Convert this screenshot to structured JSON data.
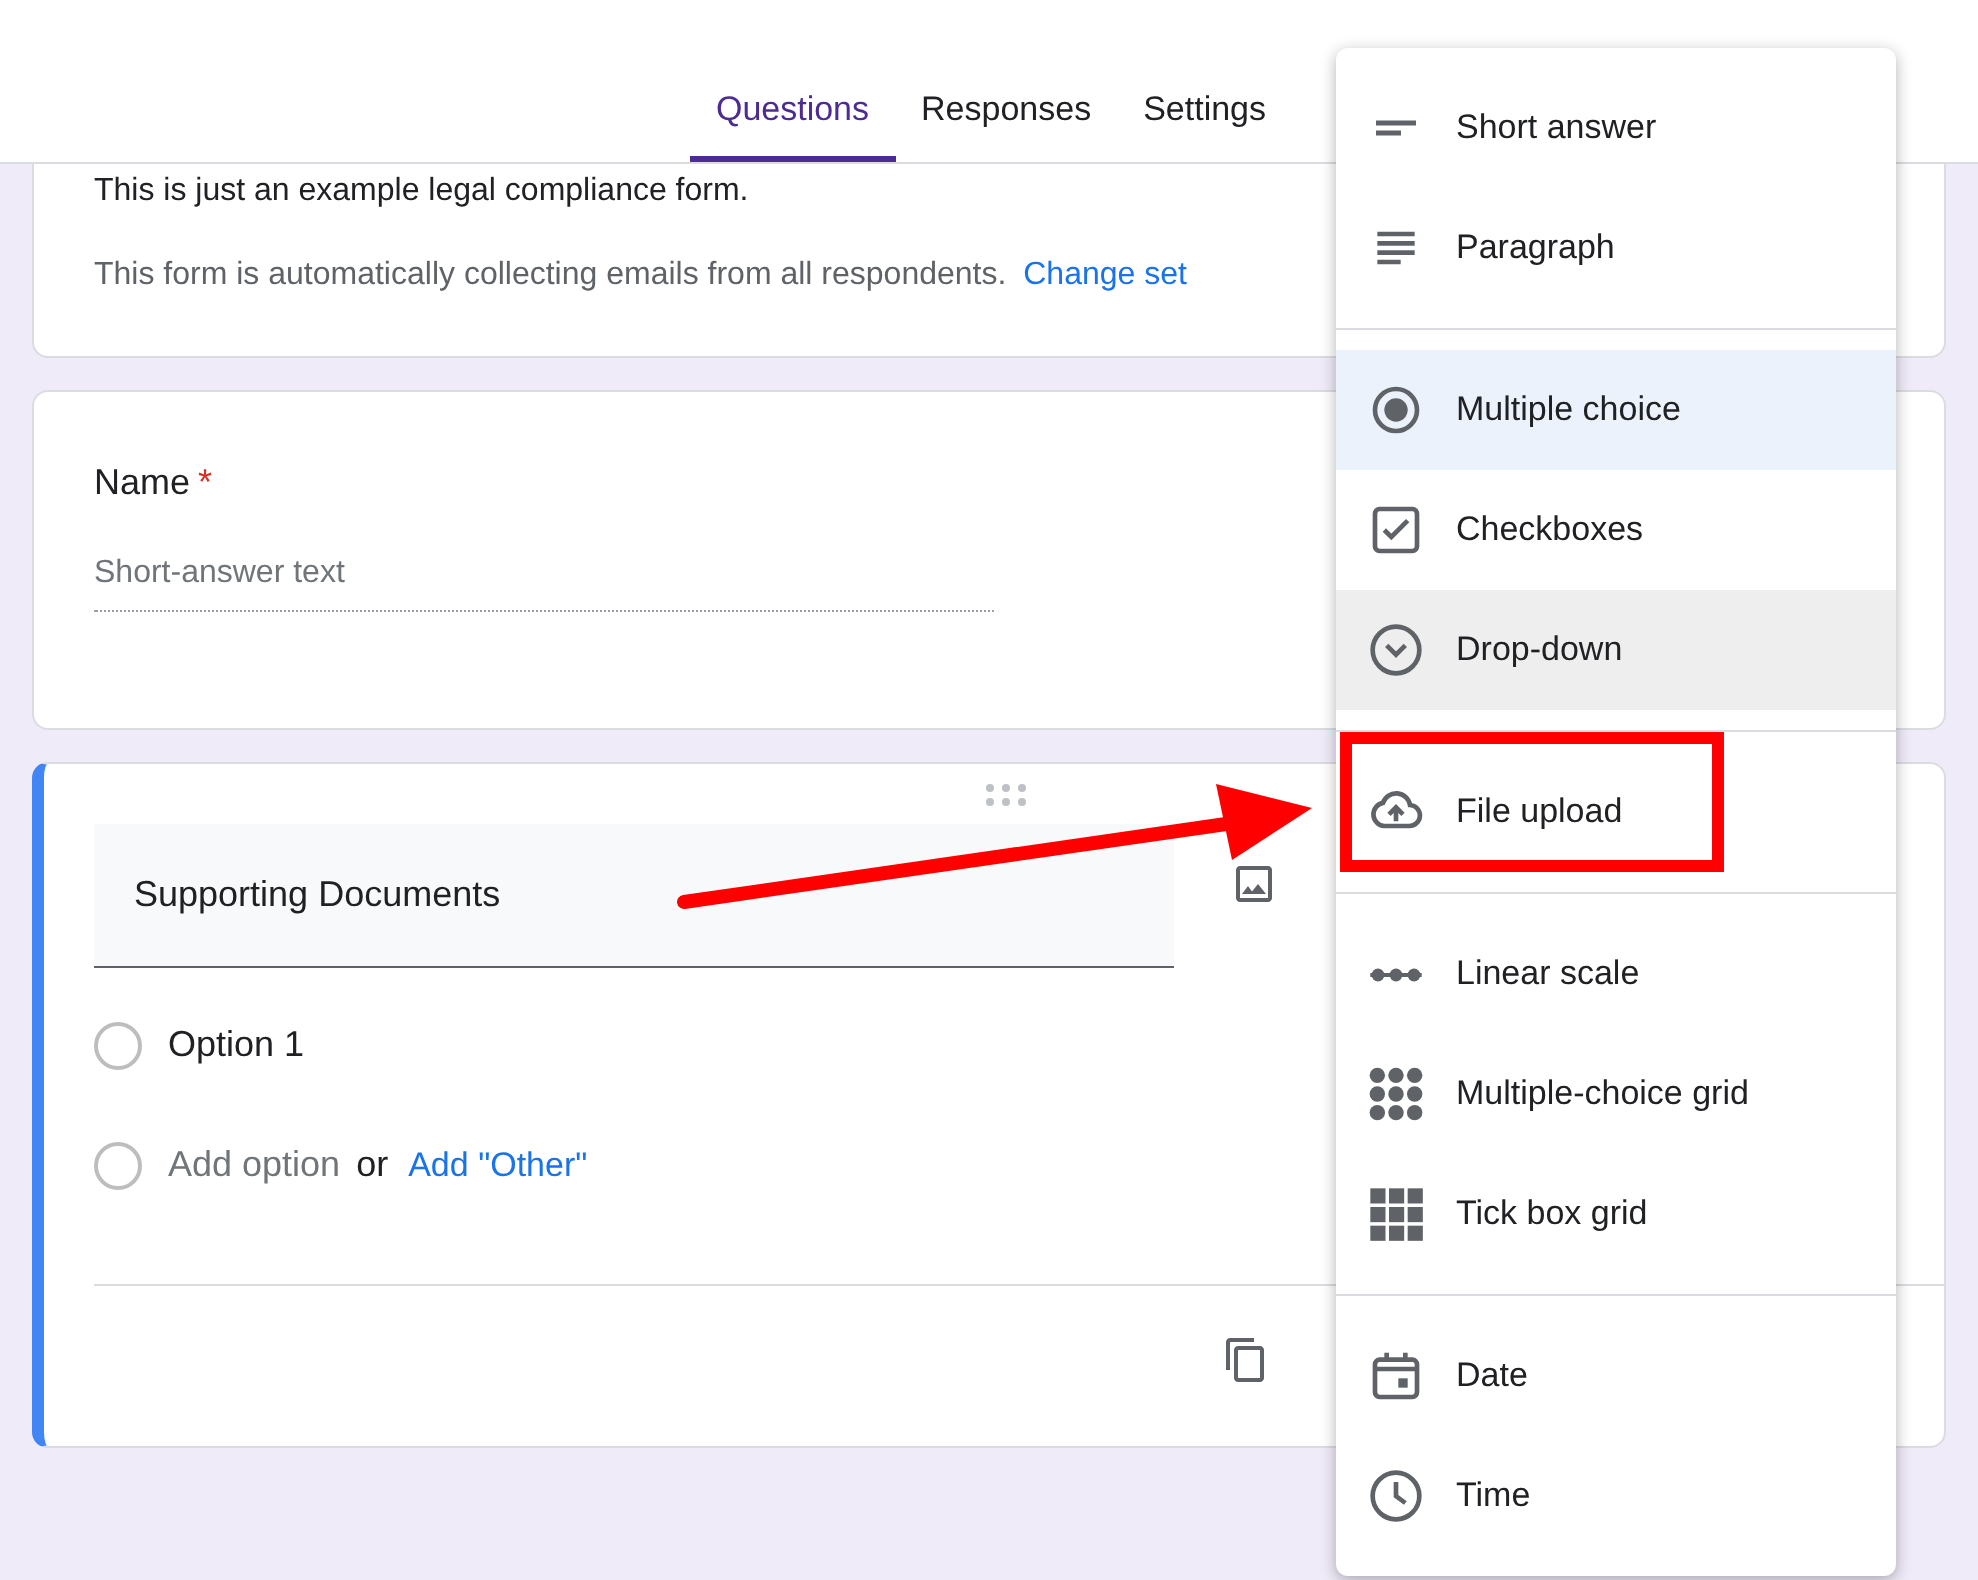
{
  "tabs": [
    {
      "label": "Questions",
      "selected": true
    },
    {
      "label": "Responses",
      "selected": false
    },
    {
      "label": "Settings",
      "selected": false
    }
  ],
  "form_header": {
    "description": "This is just an example legal compliance form.",
    "notice": "This form is automatically collecting emails from all respondents.",
    "notice_link": "Change set"
  },
  "name_question": {
    "title": "Name",
    "required_mark": "*",
    "placeholder": "Short-answer text"
  },
  "active_question": {
    "title": "Supporting Documents",
    "options": [
      {
        "label": "Option 1"
      }
    ],
    "add_option": "Add option",
    "or": "or",
    "add_other": "Add \"Other\""
  },
  "type_menu": [
    {
      "kind": "short_answer",
      "label": "Short answer",
      "selected": false,
      "highlighted": false,
      "marked": false,
      "divider_before": false
    },
    {
      "kind": "paragraph",
      "label": "Paragraph",
      "selected": false,
      "highlighted": false,
      "marked": false,
      "divider_before": false
    },
    {
      "kind": "multiple_choice",
      "label": "Multiple choice",
      "selected": true,
      "highlighted": false,
      "marked": false,
      "divider_before": true
    },
    {
      "kind": "checkboxes",
      "label": "Checkboxes",
      "selected": false,
      "highlighted": false,
      "marked": false,
      "divider_before": false
    },
    {
      "kind": "dropdown",
      "label": "Drop-down",
      "selected": false,
      "highlighted": true,
      "marked": false,
      "divider_before": false
    },
    {
      "kind": "file_upload",
      "label": "File upload",
      "selected": false,
      "highlighted": false,
      "marked": true,
      "divider_before": true
    },
    {
      "kind": "linear_scale",
      "label": "Linear scale",
      "selected": false,
      "highlighted": false,
      "marked": false,
      "divider_before": true
    },
    {
      "kind": "mc_grid",
      "label": "Multiple-choice grid",
      "selected": false,
      "highlighted": false,
      "marked": false,
      "divider_before": false
    },
    {
      "kind": "tick_grid",
      "label": "Tick box grid",
      "selected": false,
      "highlighted": false,
      "marked": false,
      "divider_before": false
    },
    {
      "kind": "date",
      "label": "Date",
      "selected": false,
      "highlighted": false,
      "marked": false,
      "divider_before": true
    },
    {
      "kind": "time",
      "label": "Time",
      "selected": false,
      "highlighted": false,
      "marked": false,
      "divider_before": false
    }
  ]
}
